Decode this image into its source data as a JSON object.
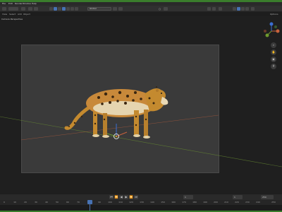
{
  "window": {
    "menu": [
      "File",
      "Edit",
      "Render",
      "Window",
      "Help"
    ]
  },
  "header": {
    "orientation_label": "Global",
    "shading_buttons": [
      "wireframe-shading",
      "solid-shading",
      "material-shading",
      "rendered-shading"
    ]
  },
  "subheader": {
    "items": [
      "View",
      "Select",
      "Add",
      "Object"
    ],
    "options_label": "Options"
  },
  "viewport": {
    "label": "Camera Perspective"
  },
  "timeline": {
    "transport_icons": [
      "⏮",
      "⏪",
      "◀",
      "▶",
      "⏩",
      "⏭"
    ],
    "start_frame": "1",
    "end_frame": "250",
    "current_frame": "1",
    "ticks": [
      "0",
      "10",
      "20",
      "30",
      "40",
      "50",
      "60",
      "70",
      "80",
      "90",
      "100",
      "110",
      "120",
      "130",
      "140",
      "150",
      "160",
      "170",
      "180",
      "190",
      "200",
      "210",
      "220",
      "230",
      "240",
      "250"
    ]
  },
  "colors": {
    "accent": "#4772b3",
    "window_border": "#3a7d2c",
    "x_axis": "#c9623c",
    "y_axis": "#6f9a2e",
    "z_axis": "#3b6fd1"
  },
  "icons": [
    "x-axis-gizmo",
    "y-axis-gizmo",
    "z-axis-gizmo",
    "zoom-icon",
    "pan-icon",
    "camera-icon",
    "grid-icon",
    "leopard-model",
    "empty-origin"
  ]
}
